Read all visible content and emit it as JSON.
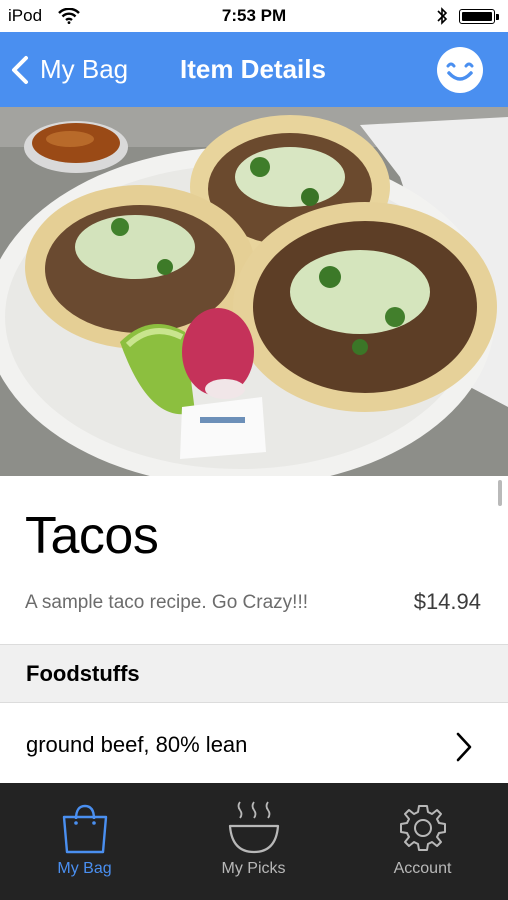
{
  "status_bar": {
    "carrier": "iPod",
    "time": "7:53 PM"
  },
  "nav": {
    "back_label": "My Bag",
    "title": "Item Details",
    "accent": "#4a8ff0"
  },
  "item": {
    "name": "Tacos",
    "description": "A sample taco recipe. Go Crazy!!!",
    "price": "$14.94",
    "photo_alt": "tacos-photo"
  },
  "section": {
    "title": "Foodstuffs"
  },
  "ingredients": [
    {
      "label": "ground beef, 80% lean",
      "icon": "chevron-right-icon"
    }
  ],
  "tabs": [
    {
      "label": "My Bag",
      "icon": "shopping-bag-icon",
      "active": true
    },
    {
      "label": "My Picks",
      "icon": "bowl-icon",
      "active": false
    },
    {
      "label": "Account",
      "icon": "gear-icon",
      "active": false
    }
  ]
}
